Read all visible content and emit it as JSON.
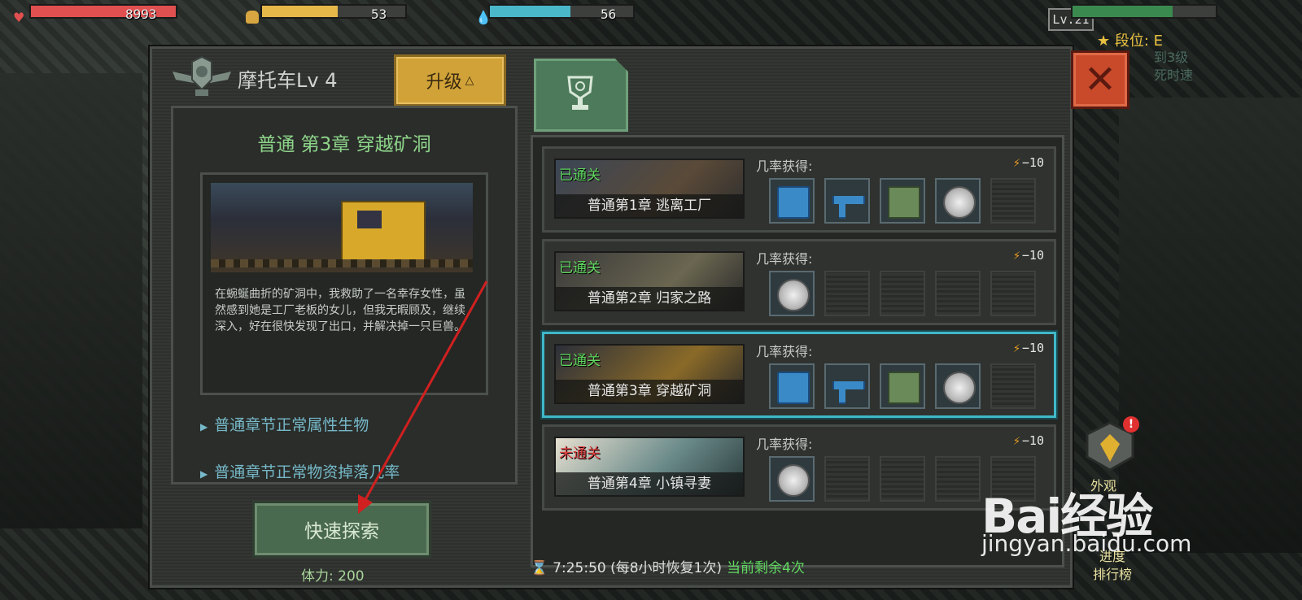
{
  "hud": {
    "hp": {
      "value": "8993",
      "fill": 1.0,
      "color": "#e05050"
    },
    "food": {
      "value": "53",
      "fill": 0.53,
      "color": "#e6b84a"
    },
    "water": {
      "value": "56",
      "fill": 0.56,
      "color": "#4ab8c8"
    },
    "level": "Lv.21",
    "xp": {
      "fill": 0.7,
      "color": "#3a8a50"
    },
    "rank": "★ 段位: E",
    "rank_sub_line1": "到3级",
    "rank_sub_line2": "死时速"
  },
  "vehicle": {
    "title": "摩托车Lv 4",
    "upgrade_label": "升级",
    "upgrade_icon": "triangle-up-icon"
  },
  "chapter": {
    "title": "普通 第3章 穿越矿洞",
    "description": "在蜿蜒曲折的矿洞中，我救助了一名幸存女性，虽然感到她是工厂老板的女儿，但我无暇顾及，继续深入，好在很快发现了出口，并解决掉一只巨兽。",
    "link1": "普通章节正常属性生物",
    "link2": "普通章节正常物资掉落几率"
  },
  "quick_explore": {
    "label": "快速探索",
    "stamina": "体力: 200"
  },
  "stages": [
    {
      "status": "已通关",
      "name": "普通第1章 逃离工厂",
      "chance": "几率获得:",
      "cost": "−10",
      "items": [
        "blue",
        "gun",
        "green",
        "coin",
        "empty"
      ],
      "selected": false
    },
    {
      "status": "已通关",
      "name": "普通第2章 归家之路",
      "chance": "几率获得:",
      "cost": "−10",
      "items": [
        "coin",
        "empty",
        "empty",
        "empty",
        "empty"
      ],
      "selected": false
    },
    {
      "status": "已通关",
      "name": "普通第3章 穿越矿洞",
      "chance": "几率获得:",
      "cost": "−10",
      "items": [
        "blue",
        "gun",
        "green",
        "coin",
        "empty"
      ],
      "selected": true
    },
    {
      "status": "未通关",
      "name": "普通第4章 小镇寻妻",
      "chance": "几率获得:",
      "cost": "−10",
      "items": [
        "coin",
        "empty",
        "empty",
        "empty",
        "empty"
      ],
      "selected": false
    }
  ],
  "timer": {
    "time": "7:25:50 (每8小时恢复1次)",
    "remain": "当前剩余4次"
  },
  "side": {
    "appearance": "外观",
    "progress": "进度",
    "leaderboard": "排行榜",
    "alert": "!"
  },
  "watermark": {
    "brand": "Bai经验",
    "url": "jingyan.baidu.com"
  }
}
